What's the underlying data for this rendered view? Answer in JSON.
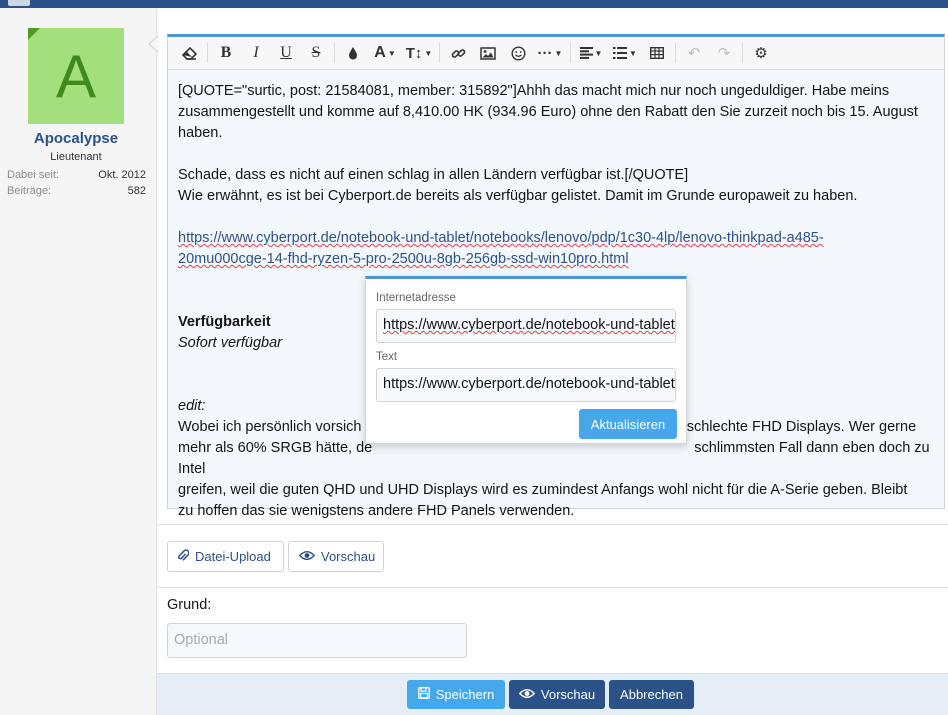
{
  "user": {
    "avatar_letter": "A",
    "name": "Apocalypse",
    "title": "Lieutenant",
    "stats": [
      {
        "label": "Dabei seit:",
        "value": "Okt. 2012"
      },
      {
        "label": "Beiträge:",
        "value": "582"
      }
    ]
  },
  "toolbar": {
    "buttons": [
      "eraser-icon",
      "bold-icon",
      "italic-icon",
      "underline-icon",
      "strikethrough-icon",
      "color-icon",
      "font-size-icon",
      "text-style-icon",
      "link-icon",
      "image-icon",
      "smiley-icon",
      "more-icon",
      "align-icon",
      "list-icon",
      "table-icon",
      "undo-icon",
      "redo-icon",
      "settings-icon"
    ]
  },
  "editor": {
    "quote_open": "[QUOTE=\"surtic, post: 21584081, member: 315892\"]Ahhh das macht mich nur noch ungeduldiger. Habe meins zusammengestellt und komme auf 8,410.00 HK (934.96 Euro) ohne den Rabatt den Sie zurzeit noch bis 15. August haben.",
    "quote_close": "Schade, dass es nicht auf einen schlag in allen Ländern verfügbar ist.[/QUOTE]",
    "line_cyberport": "Wie erwähnt, es ist bei Cyberport.de bereits als verfügbar gelistet. Damit im Grunde europaweit zu haben.",
    "url_line1": "https://www.cyberport.de/notebook-und-tablet/notebooks/lenovo/pdp/1c30-4lp/lenovo-thinkpad-a485-",
    "url_line2": "20mu000cge-14-fhd-ryzen-5-pro-2500u-8gb-256gb-ssd-win10pro.html",
    "availability_title": "Verfügbarkeit",
    "availability_value": "Sofort verfügbar",
    "edit_label": "edit:",
    "edit_line1_a": "Wobei ich persönlich vorsich",
    "edit_line1_b": "l schlechte FHD Displays. Wer gerne",
    "edit_line2_a": "mehr als 60% SRGB hätte, de",
    "edit_line2_b": "schlimmsten Fall dann eben doch zu Intel",
    "edit_line3": "greifen, weil die guten QHD und UHD Displays wird es zumindest Anfangs wohl nicht für die A-Serie geben. Bleibt",
    "edit_line4": "zu hoffen das sie wenigstens andere FHD Panels verwenden."
  },
  "link_popup": {
    "url_label": "Internetadresse",
    "url_value": "https://www.cyberport.de/notebook-und-tablet/notebooks",
    "text_label": "Text",
    "text_value": "https://www.cyberport.de/notebook-und-tablet/notebooks",
    "update_button": "Aktualisieren"
  },
  "attachments": {
    "upload_button": "Datei-Upload",
    "preview_button": "Vorschau"
  },
  "reason": {
    "label": "Grund:",
    "placeholder": "Optional"
  },
  "footer": {
    "save_button": "Speichern",
    "preview_button": "Vorschau",
    "cancel_button": "Abbrechen"
  },
  "colors": {
    "accent": "#4e94d0",
    "brand": "#2b5288",
    "avatar_bg": "#a3df7c",
    "avatar_fg": "#3f8a1c"
  }
}
